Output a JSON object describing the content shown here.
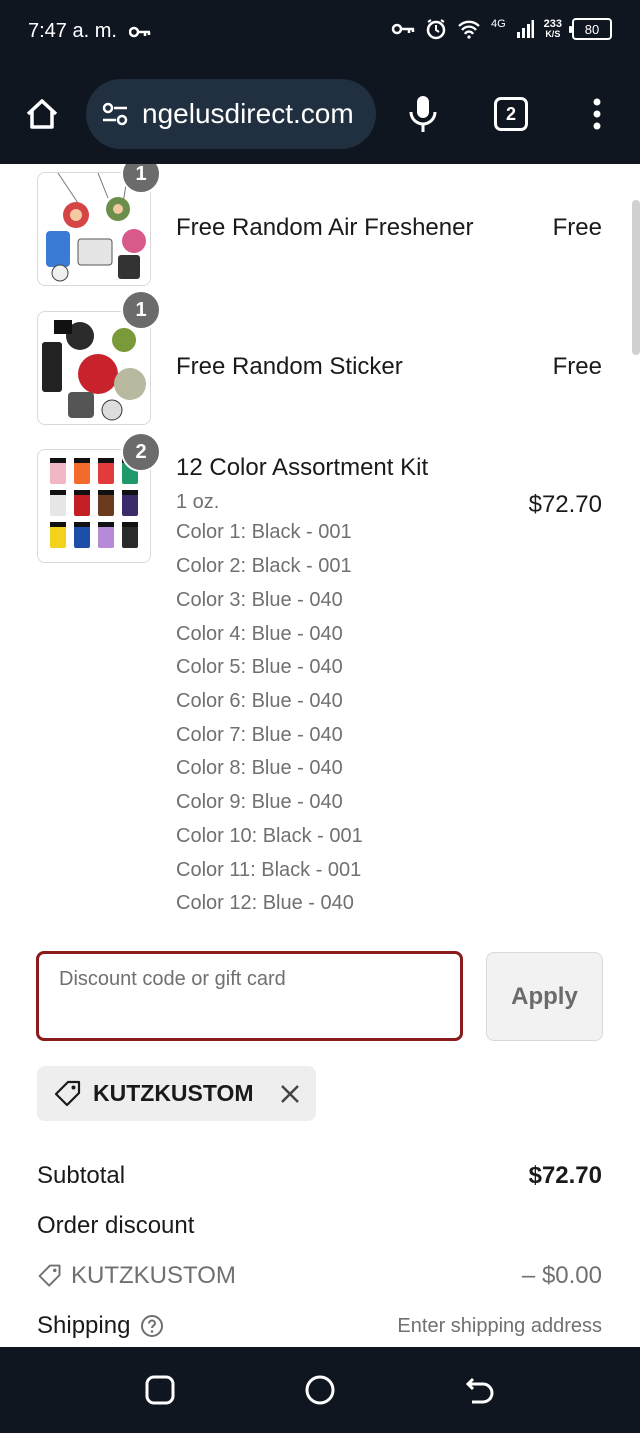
{
  "status_bar": {
    "time": "7:47 a. m.",
    "network": "4G",
    "speed_value": "233",
    "speed_unit": "K/S",
    "battery": "80"
  },
  "browser": {
    "url": "ngelusdirect.com",
    "tab_count": "2"
  },
  "line_items": [
    {
      "quantity": "1",
      "title": "Free Random Air Freshener",
      "price": "Free"
    },
    {
      "quantity": "1",
      "title": "Free Random Sticker",
      "price": "Free"
    },
    {
      "quantity": "2",
      "title": "12 Color Assortment Kit",
      "price": "$72.70",
      "size": "1 oz.",
      "options": [
        "Color 1: Black - 001",
        "Color 2: Black - 001",
        "Color 3: Blue - 040",
        "Color 4: Blue - 040",
        "Color 5: Blue - 040",
        "Color 6: Blue - 040",
        "Color 7: Blue - 040",
        "Color 8: Blue - 040",
        "Color 9: Blue - 040",
        "Color 10: Black - 001",
        "Color 11: Black - 001",
        "Color 12: Blue - 040"
      ]
    }
  ],
  "discount": {
    "placeholder": "Discount code or gift card",
    "value": "",
    "apply_label": "Apply",
    "applied_code": "KUTZKUSTOM"
  },
  "summary": {
    "subtotal_label": "Subtotal",
    "subtotal_value": "$72.70",
    "order_discount_label": "Order discount",
    "discount_code": "KUTZKUSTOM",
    "discount_value": "– $0.00",
    "shipping_label": "Shipping",
    "shipping_value": "Enter shipping address"
  },
  "colors": {
    "chrome": "#0f1620",
    "url_pill": "#203041",
    "input_focus_border": "#8b1a1a",
    "qty_badge": "#6b6b6b"
  }
}
